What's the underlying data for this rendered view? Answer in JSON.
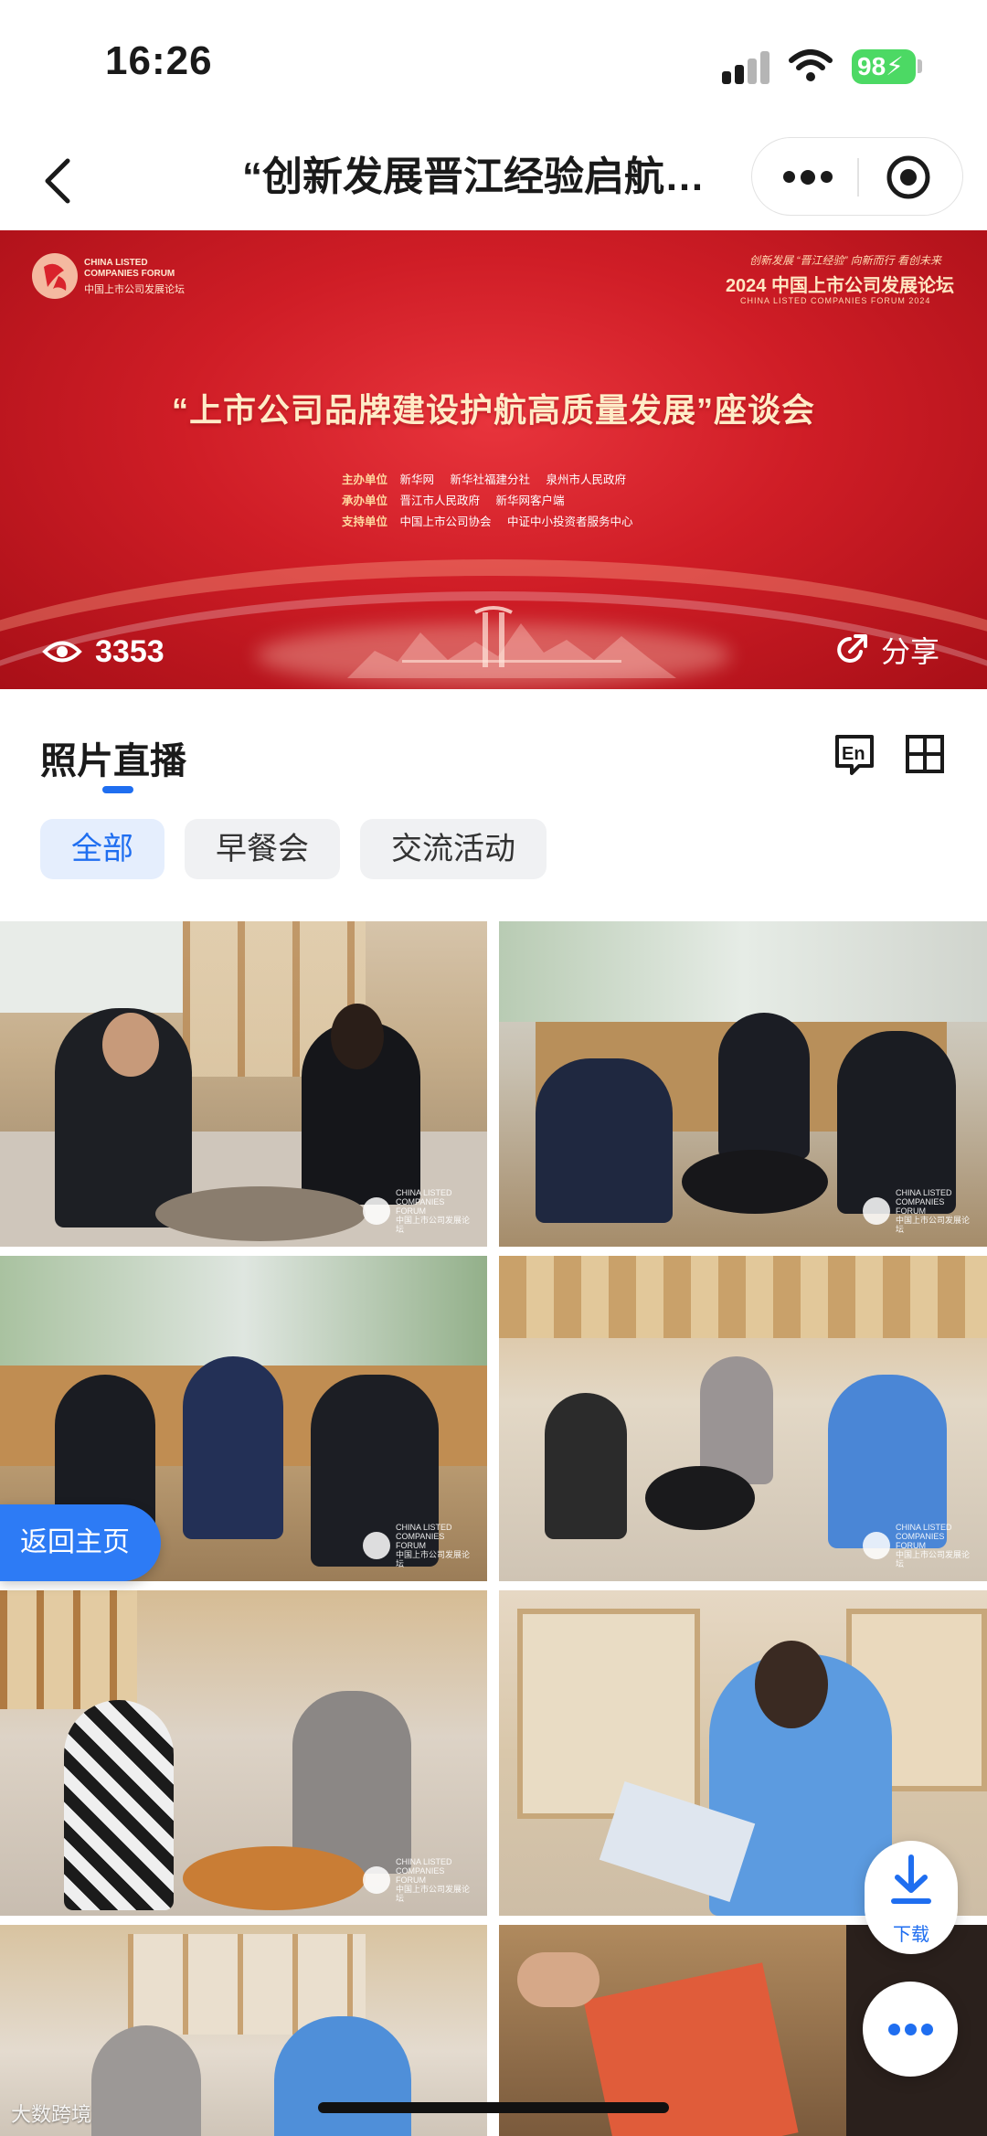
{
  "status_bar": {
    "time": "16:26",
    "battery": "98"
  },
  "nav": {
    "title": "“创新发展晋江经验启航…"
  },
  "banner": {
    "logo_en": "CHINA LISTED COMPANIES FORUM",
    "logo_cn": "中国上市公司发展论坛",
    "slogan": "创新发展 “晋江经验” 向新而行 看创未来",
    "forum_name": "2024 中国上市公司发展论坛",
    "forum_name_en": "CHINA LISTED COMPANIES FORUM 2024",
    "headline": "“上市公司品牌建设护航高质量发展”座谈会",
    "credits": [
      {
        "label": "主办单位",
        "orgs": [
          "新华网",
          "新华社福建分社",
          "泉州市人民政府"
        ]
      },
      {
        "label": "承办单位",
        "orgs": [
          "晋江市人民政府",
          "新华网客户端"
        ]
      },
      {
        "label": "支持单位",
        "orgs": [
          "中国上市公司协会",
          "中证中小投资者服务中心"
        ]
      }
    ],
    "views": "3353",
    "share_label": "分享"
  },
  "section": {
    "title": "照片直播"
  },
  "tabs": [
    {
      "label": "全部",
      "active": true
    },
    {
      "label": "早餐会",
      "active": false
    },
    {
      "label": "交流活动",
      "active": false
    }
  ],
  "photo_watermark": {
    "en": "CHINA LISTED COMPANIES FORUM",
    "cn": "中国上市公司发展论坛"
  },
  "floating": {
    "home_label": "返回主页",
    "download_label": "下载"
  },
  "bottom_watermark": "大数跨境",
  "colors": {
    "accent": "#1f6ef0",
    "banner_red": "#cf1d26",
    "chip_bg": "#f0f1f3"
  }
}
